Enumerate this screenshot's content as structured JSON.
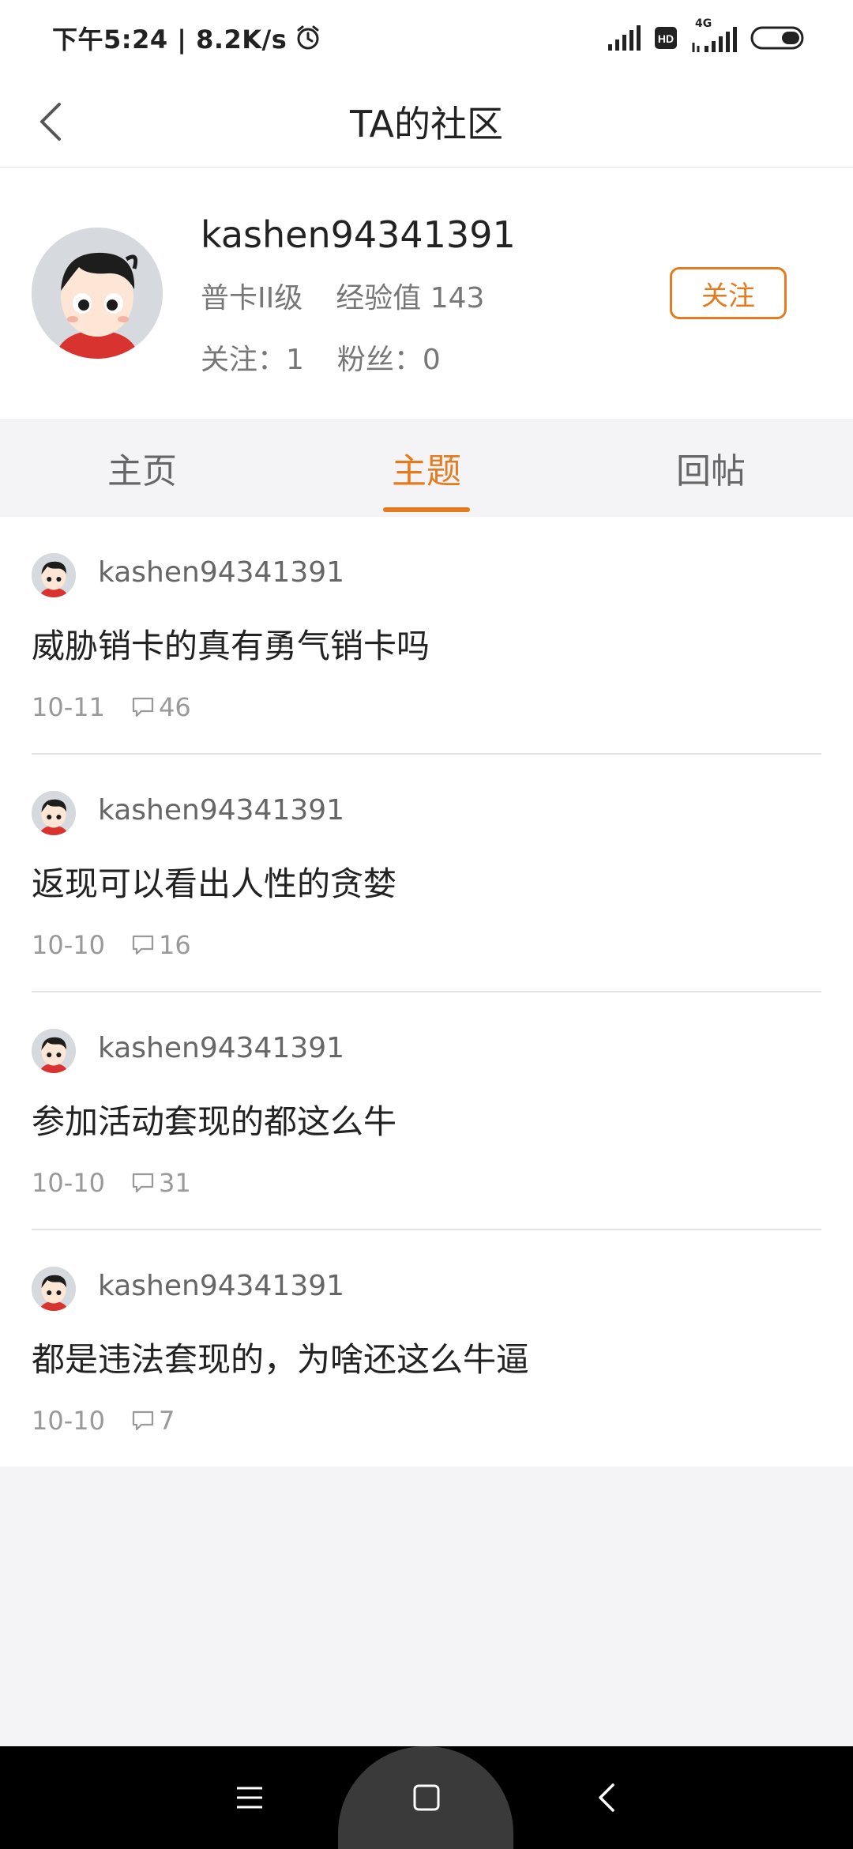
{
  "status_bar": {
    "time_speed": "下午5:24 | 8.2K/s",
    "network_label": "4G"
  },
  "header": {
    "title": "TA的社区"
  },
  "profile": {
    "username": "kashen94341391",
    "level": "普卡II级",
    "exp": "经验值 143",
    "following": "关注：1",
    "followers": "粉丝：0",
    "follow_button": "关注"
  },
  "tabs": [
    {
      "label": "主页",
      "active": false
    },
    {
      "label": "主题",
      "active": true
    },
    {
      "label": "回帖",
      "active": false
    }
  ],
  "posts": [
    {
      "user": "kashen94341391",
      "title": "威胁销卡的真有勇气销卡吗",
      "date": "10-11",
      "comments": "46"
    },
    {
      "user": "kashen94341391",
      "title": "返现可以看出人性的贪婪",
      "date": "10-10",
      "comments": "16"
    },
    {
      "user": "kashen94341391",
      "title": "参加活动套现的都这么牛",
      "date": "10-10",
      "comments": "31"
    },
    {
      "user": "kashen94341391",
      "title": "都是违法套现的，为啥还这么牛逼",
      "date": "10-10",
      "comments": "7"
    }
  ],
  "colors": {
    "accent": "#e57b1f",
    "text_primary": "#222222",
    "text_secondary": "#777777",
    "background": "#f4f4f6"
  }
}
